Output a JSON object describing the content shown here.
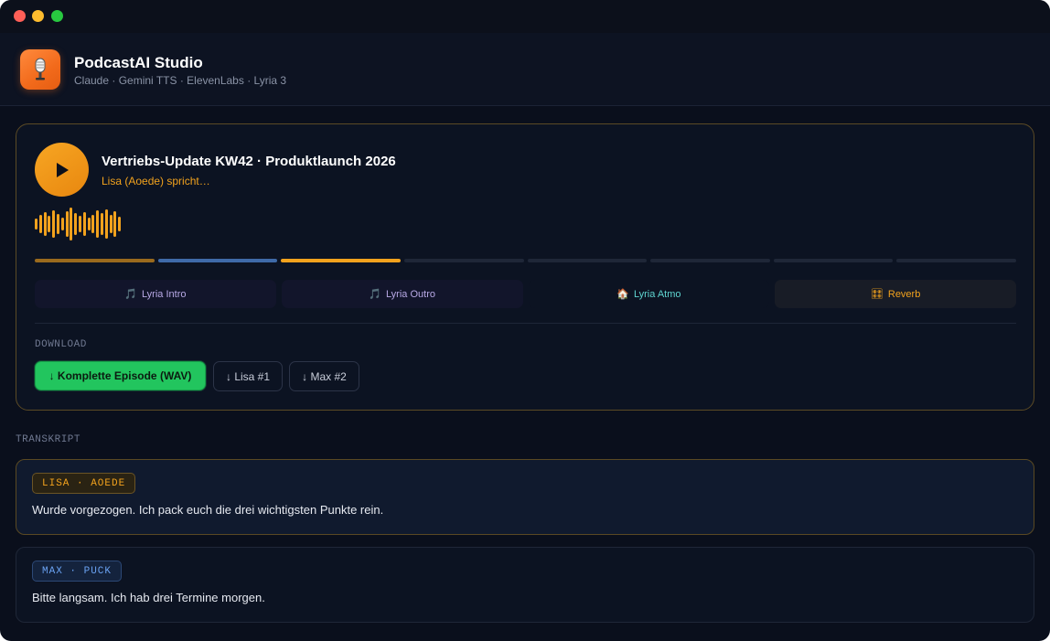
{
  "app": {
    "title": "PodcastAI Studio",
    "subtitle": "Claude · Gemini TTS · ElevenLabs · Lyria 3",
    "icon": "microphone-icon"
  },
  "player": {
    "episode_title": "Vertriebs-Update KW42 · Produktlaunch 2026",
    "status": "Lisa (Aoede) spricht…",
    "play_icon": "play-icon",
    "segments": [
      {
        "state": "done-lisa",
        "color": "#9a6a1d"
      },
      {
        "state": "done-max",
        "color": "#3f6aa8"
      },
      {
        "state": "playing",
        "color": "#f2a21d"
      },
      {
        "state": "pending",
        "color": "#1f2738"
      },
      {
        "state": "pending",
        "color": "#1f2738"
      },
      {
        "state": "pending",
        "color": "#1f2738"
      },
      {
        "state": "pending",
        "color": "#1f2738"
      },
      {
        "state": "pending",
        "color": "#1f2738"
      }
    ],
    "effects": [
      {
        "icon": "🎵",
        "label": "Lyria Intro",
        "color": "#b8a9e6",
        "bg": "#12152b"
      },
      {
        "icon": "🎵",
        "label": "Lyria Outro",
        "color": "#b8a9e6",
        "bg": "#12152b"
      },
      {
        "icon": "🏠",
        "label": "Lyria Atmo",
        "color": "#5fd4d0",
        "bg": "#0c1322"
      },
      {
        "icon": "🎛",
        "label": "Reverb",
        "color": "#f2a21d",
        "bg": "#181c26"
      }
    ]
  },
  "download": {
    "label": "DOWNLOAD",
    "full_episode": "↓ Komplette Episode (WAV)",
    "lisa": "↓ Lisa #1",
    "max": "↓ Max #2"
  },
  "transcript": {
    "label": "TRANSKRIPT",
    "entries": [
      {
        "speaker": "LISA · AOEDE",
        "text": "Wurde vorgezogen. Ich pack euch die drei wichtigsten Punkte rein."
      },
      {
        "speaker": "MAX · PUCK",
        "text": "Bitte langsam. Ich hab drei Termine morgen."
      }
    ]
  },
  "colors": {
    "accent": "#f2a21d",
    "download_green": "#22c55e",
    "max_blue": "#6aa2f2"
  }
}
